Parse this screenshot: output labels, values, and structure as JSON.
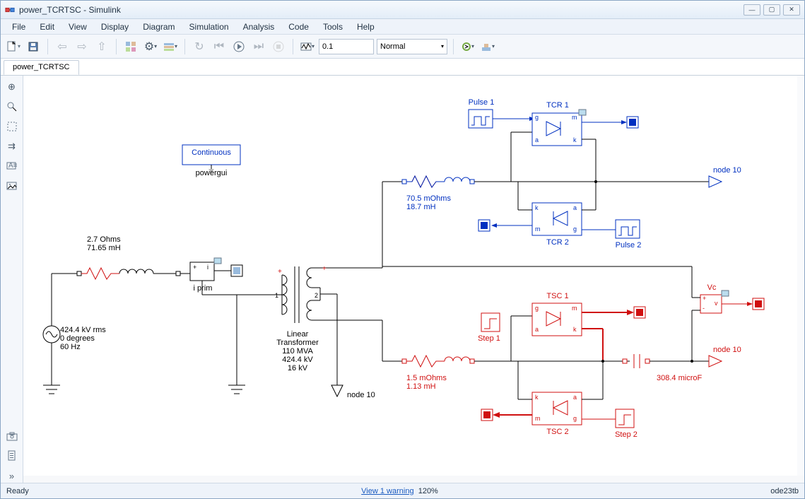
{
  "window": {
    "title": "power_TCRTSC - Simulink"
  },
  "menu": [
    "File",
    "Edit",
    "View",
    "Display",
    "Diagram",
    "Simulation",
    "Analysis",
    "Code",
    "Tools",
    "Help"
  ],
  "toolbar": {
    "step": "0.1",
    "mode": "Normal"
  },
  "tab": "power_TCRTSC",
  "status": {
    "left": "Ready",
    "warning": "View 1 warning",
    "zoom": "120%",
    "solver": "ode23tb"
  },
  "diagram": {
    "powergui": {
      "title": "Continuous",
      "label": "powergui"
    },
    "rl1": "2.7 Ohms\n71.65 mH",
    "iprim": "i prim",
    "src": "424.4 kV rms\n0 degrees\n60 Hz",
    "xfmr": "Linear\nTransformer\n110 MVA\n424.4 kV\n16 kV",
    "xfmr_node": "node 10",
    "rl_blue": "70.5 mOhms\n18.7 mH",
    "rl_red": "1.5 mOhms\n1.13 mH",
    "pulse1": "Pulse 1",
    "pulse2": "Pulse 2",
    "tcr1": "TCR 1",
    "tcr2": "TCR 2",
    "step1": "Step 1",
    "step2": "Step 2",
    "tsc1": "TSC 1",
    "tsc2": "TSC 2",
    "node10a": "node 10",
    "node10b": "node 10",
    "vc": "Vc",
    "cap": "308.4 microF",
    "ports": {
      "g": "g",
      "a": "a",
      "m": "m",
      "k": "k",
      "plus": "+",
      "minus": "-",
      "v": "v",
      "i": "i",
      "one": "1",
      "two": "2"
    }
  }
}
